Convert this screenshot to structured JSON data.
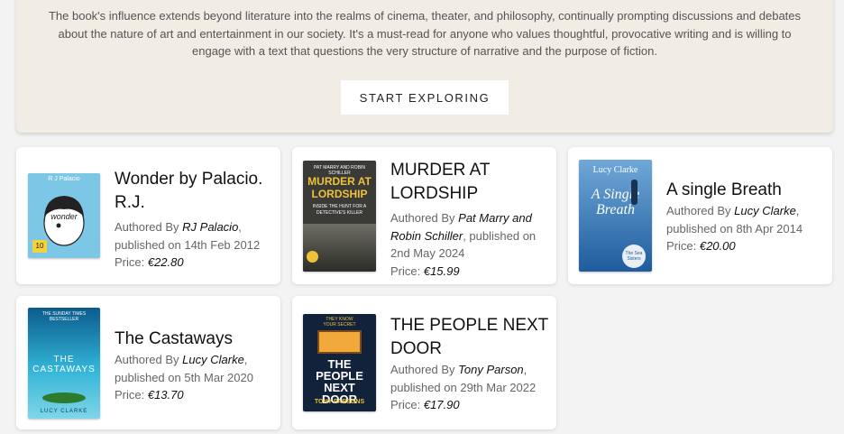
{
  "hero": {
    "description": "The book's influence extends beyond literature into the realms of cinema, theater, and philosophy, continually prompting discussions and debates about the nature of art and entertainment in our society. It's a must-read for anyone who values thoughtful, provocative writing and is willing to engage with a text that questions the very structure of narrative and the purpose of fiction.",
    "button_label": "START EXPLORING"
  },
  "labels": {
    "authored_by": "Authored By ",
    "published_on": ", published on ",
    "price_prefix": "Price: "
  },
  "books": [
    {
      "title": "Wonder by Palacio. R.J.",
      "author": "RJ Palacio",
      "date": "14th Feb 2012",
      "price": "€22.80",
      "cover": {
        "bg": "#7cc6e6",
        "top_text": "R J Palacio",
        "main_text": "wonder",
        "bottom_text": "10"
      }
    },
    {
      "title": "MURDER AT LORDSHIP",
      "author": "Pat Marry and Robin Schiller",
      "date": "2nd May 2024",
      "price": "€15.99",
      "cover": {
        "bg": "#3a3a36",
        "top_text": "PAT MARRY AND ROBIN SCHILLER",
        "main_text": "MURDER AT LORDSHIP",
        "bottom_text": "INSIDE THE HUNT FOR A DETECTIVE'S KILLER"
      }
    },
    {
      "title": "A single Breath",
      "author": "Lucy Clarke",
      "date": "8th Apr 2014",
      "price": "€20.00",
      "cover": {
        "bg": "#2f6fb0",
        "top_text": "Lucy Clarke",
        "main_text": "A Single Breath",
        "bottom_text": "The Sea Sisters"
      }
    },
    {
      "title": "The Castaways",
      "author": "Lucy Clarke",
      "date": "5th Mar 2020",
      "price": "€13.70",
      "cover": {
        "bg": "#1fa3c9",
        "top_text": "THE SUNDAY TIMES BESTSELLER",
        "main_text": "THE CASTAWAYS",
        "bottom_text": "LUCY CLARKE"
      }
    },
    {
      "title": "THE PEOPLE NEXT DOOR",
      "author": "Tony Parson",
      "date": "29th Mar 2022",
      "price": "€17.90",
      "cover": {
        "bg": "#12223a",
        "top_text": "THEY KNOW YOUR SECRET",
        "main_text": "THE PEOPLE NEXT DOOR",
        "bottom_text": "TONY PARSONS"
      }
    }
  ]
}
